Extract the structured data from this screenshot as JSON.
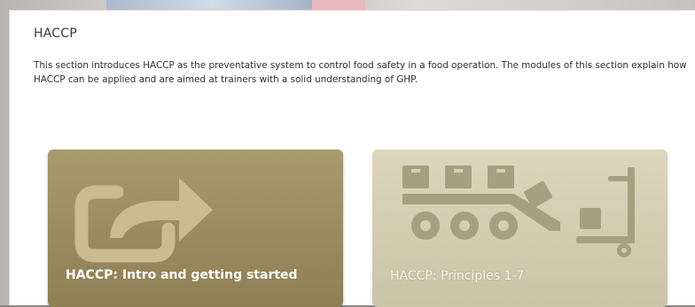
{
  "section": {
    "title": "HACCP",
    "intro": "This section introduces HACCP as the preventative system to control food safety in a food operation. The modules of this section explain how HACCP can be applied and are aimed at trainers with a solid understanding of GHP."
  },
  "modules": [
    {
      "label": "HACCP: Intro and getting started",
      "icon": "share-arrow-icon",
      "state": "active"
    },
    {
      "label": "HACCP: Principles 1-7",
      "icon": "conveyor-boxes-icon",
      "state": "inactive"
    }
  ],
  "colors": {
    "tile_active": "#9a8a5f",
    "tile_inactive": "#d6cfb4",
    "panel_border": "#f1c9cd"
  }
}
